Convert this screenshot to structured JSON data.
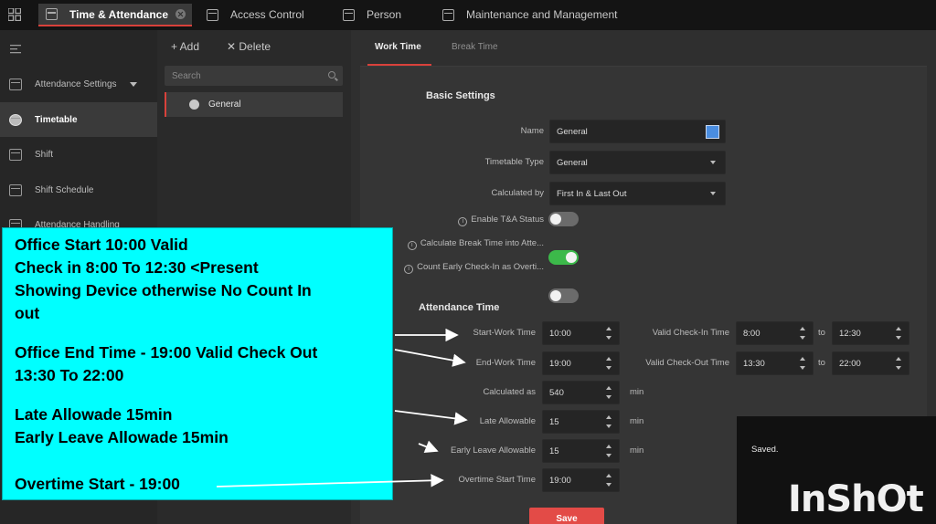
{
  "top_tabs": [
    {
      "label": "Time & Attendance",
      "icon": "calendar-icon"
    },
    {
      "label": "Access Control",
      "icon": "door-icon"
    },
    {
      "label": "Person",
      "icon": "person-icon"
    },
    {
      "label": "Maintenance and Management",
      "icon": "tools-icon"
    }
  ],
  "list_toolbar": {
    "add_label": "+ Add",
    "delete_label": "✕ Delete",
    "search_placeholder": "Search"
  },
  "sidebar": {
    "items": [
      {
        "label": "Attendance Settings",
        "icon": "attendance-settings-icon"
      },
      {
        "label": "Timetable",
        "icon": "timetable-icon"
      },
      {
        "label": "Shift",
        "icon": "shift-icon"
      },
      {
        "label": "Shift Schedule",
        "icon": "schedule-icon"
      },
      {
        "label": "Attendance Handling",
        "icon": "handling-icon"
      }
    ]
  },
  "list": {
    "items": [
      {
        "label": "General"
      }
    ]
  },
  "sub_tabs": [
    "Work Time",
    "Break Time"
  ],
  "basic": {
    "title": "Basic Settings",
    "name_label": "Name",
    "name_value": "General",
    "timetable_type_label": "Timetable Type",
    "timetable_type_value": "General",
    "calculated_by_label": "Calculated by",
    "calculated_by_value": "First In & Last Out",
    "enable_ta_label": "Enable T&A Status",
    "break_time_label": "Calculate Break Time into Atte...",
    "early_checkin_label": "Count Early Check-In as Overti...",
    "enable_ta_on": false,
    "break_time_on": true,
    "early_checkin_on": false,
    "color": "#4a8de0"
  },
  "attendance": {
    "title": "Attendance Time",
    "start_work_label": "Start-Work Time",
    "start_work_value": "10:00",
    "end_work_label": "End-Work Time",
    "end_work_value": "19:00",
    "calculated_as_label": "Calculated as",
    "calculated_as_value": "540",
    "calculated_as_unit": "min",
    "late_label": "Late Allowable",
    "late_value": "15",
    "late_unit": "min",
    "early_leave_label": "Early Leave Allowable",
    "early_leave_value": "15",
    "early_leave_unit": "min",
    "overtime_label": "Overtime Start Time",
    "overtime_value": "19:00",
    "valid_checkin_label": "Valid Check-In Time",
    "valid_checkin_from": "8:00",
    "valid_checkin_to": "12:30",
    "valid_checkout_label": "Valid Check-Out Time",
    "valid_checkout_from": "13:30",
    "valid_checkout_to": "22:00",
    "to_label": "to"
  },
  "save_label": "Save",
  "saved_toast": "Saved.",
  "watermark": "InShOt",
  "annotation": {
    "lines": [
      "Office Start 10:00 Valid",
      "Check in 8:00 To 12:30 <Present",
      "Showing Device otherwise No Count In",
      "out",
      "Office End Time - 19:00 Valid Check Out",
      "13:30 To 22:00",
      "Late Allowade 15min",
      "Early Leave Allowade 15min",
      "Overtime Start - 19:00"
    ],
    "background": "#00ffff"
  }
}
